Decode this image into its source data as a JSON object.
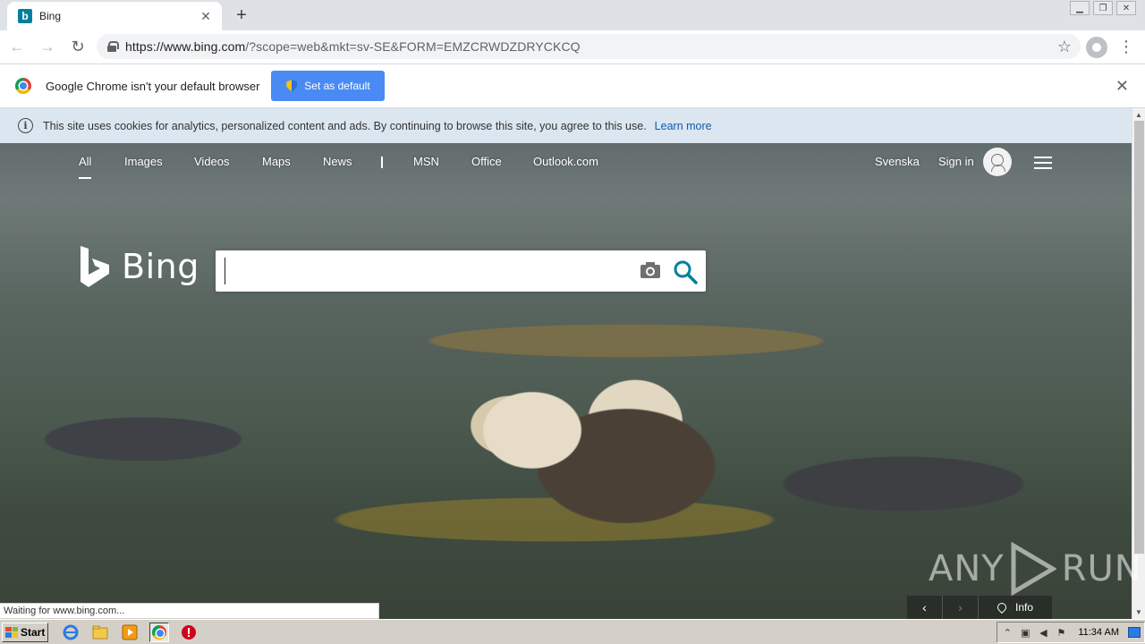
{
  "tab": {
    "title": "Bing",
    "favicon": "b"
  },
  "toolbar": {
    "url_host": "https://www.bing.com",
    "url_rest": "/?scope=web&mkt=sv-SE&FORM=EMZCRWDZDRYCKCQ"
  },
  "infobar": {
    "message": "Google Chrome isn't your default browser",
    "button_label": "Set as default"
  },
  "cookie": {
    "message": "This site uses cookies for analytics, personalized content and ads. By continuing to browse this site, you agree to this use.",
    "link": "Learn more"
  },
  "nav": {
    "all": "All",
    "images": "Images",
    "videos": "Videos",
    "maps": "Maps",
    "news": "News",
    "msn": "MSN",
    "office": "Office",
    "outlook": "Outlook.com",
    "language": "Svenska",
    "sign_in": "Sign in"
  },
  "bing": {
    "logo_text": "Bing",
    "search_value": ""
  },
  "status": {
    "text": "Waiting for www.bing.com..."
  },
  "carousel": {
    "info_label": "Info"
  },
  "watermark": {
    "left": "ANY",
    "right": "RUN"
  },
  "taskbar": {
    "start_label": "Start",
    "clock": "11:34 AM"
  },
  "colors": {
    "accent_button": "#4a8af4",
    "cookie_bar": "#dce6f0",
    "link": "#0b5cad",
    "bing_teal": "#00809d"
  }
}
